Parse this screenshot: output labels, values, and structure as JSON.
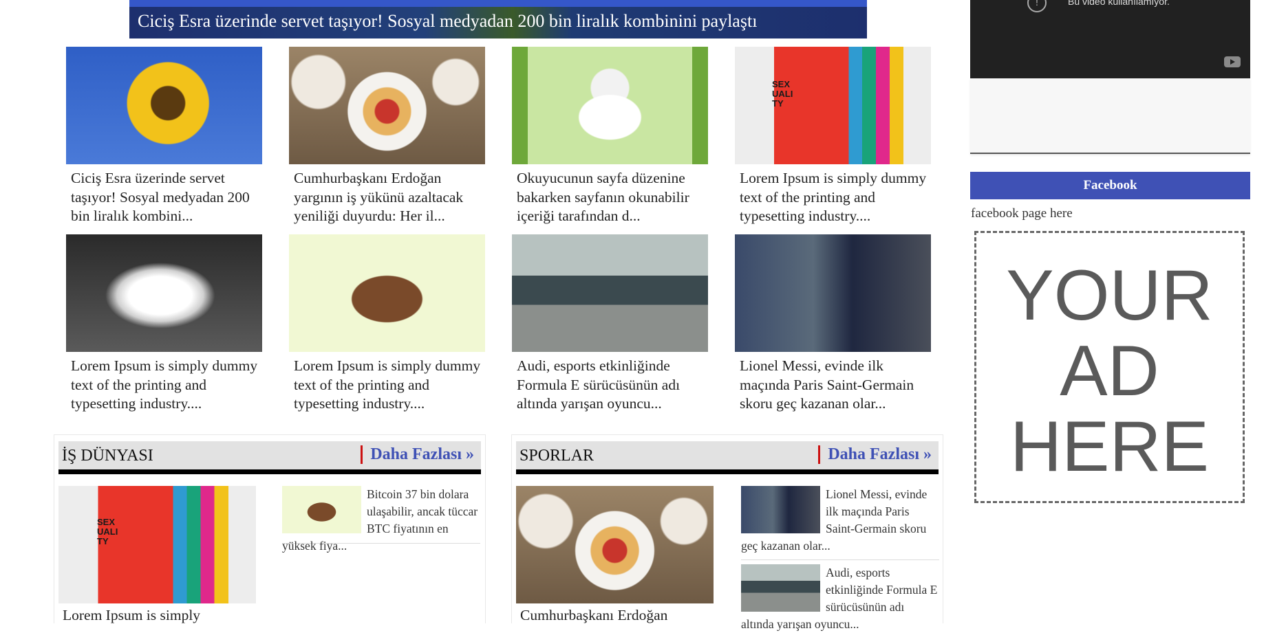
{
  "slider": {
    "caption": "Ciciş Esra üzerinde servet taşıyor! Sosyal medyadan 200 bin liralık kombinini paylaştı"
  },
  "news_grid": [
    {
      "title": "Ciciş Esra üzerinde servet taşıyor! Sosyal medyadan 200 bin liralık kombini...",
      "image": "sunflower"
    },
    {
      "title": "Cumhurbaşkanı Erdoğan yargının iş yükünü azaltacak yeniliği duyurdu: Her il...",
      "image": "tart"
    },
    {
      "title": "Okuyucunun sayfa düzenine bakarken sayfanın okunabilir içeriği tarafından d...",
      "image": "panda"
    },
    {
      "title": "Lorem Ipsum is simply dummy text of the printing and typesetting industry....",
      "image": "book"
    },
    {
      "title": "Lorem Ipsum is simply dummy text of the printing and typesetting industry....",
      "image": "kitten"
    },
    {
      "title": "Lorem Ipsum is simply dummy text of the printing and typesetting industry....",
      "image": "domo"
    },
    {
      "title": "Audi, esports etkinliğinde Formula E sürücüsünün adı altında yarışan oyuncu...",
      "image": "car"
    },
    {
      "title": "Lionel Messi, evinde ilk maçında Paris Saint-Germain skoru geç kazanan olar...",
      "image": "messi"
    }
  ],
  "book_cover_text": "SEX UALI TY",
  "sections": [
    {
      "name": "İŞ DÜNYASI",
      "more_label": "Daha Fazlası »",
      "main_title": "Lorem Ipsum is simply",
      "items": [
        {
          "text": "Bitcoin 37 bin dolara ulaşabilir, ancak tüccar BTC fiyatının en yüksek fiya..."
        }
      ]
    },
    {
      "name": "SPORLAR",
      "more_label": "Daha Fazlası »",
      "main_title": "Cumhurbaşkanı Erdoğan",
      "items": [
        {
          "text": "Lionel Messi, evinde ilk maçında Paris Saint-Germain skoru geç kazanan olar..."
        },
        {
          "text": "Audi, esports etkinliğinde Formula E sürücüsünün adı altında yarışan oyuncu..."
        }
      ]
    }
  ],
  "sidebar": {
    "video_message": "Bu video kullanılamıyor.",
    "facebook_label": "Facebook",
    "facebook_text": "facebook page here",
    "ad_lines": [
      "YOUR",
      "AD",
      "HERE"
    ]
  },
  "colors": {
    "accent": "#3f51b5",
    "divider_red": "#cc1111",
    "section_bg": "#e2e2e2"
  }
}
